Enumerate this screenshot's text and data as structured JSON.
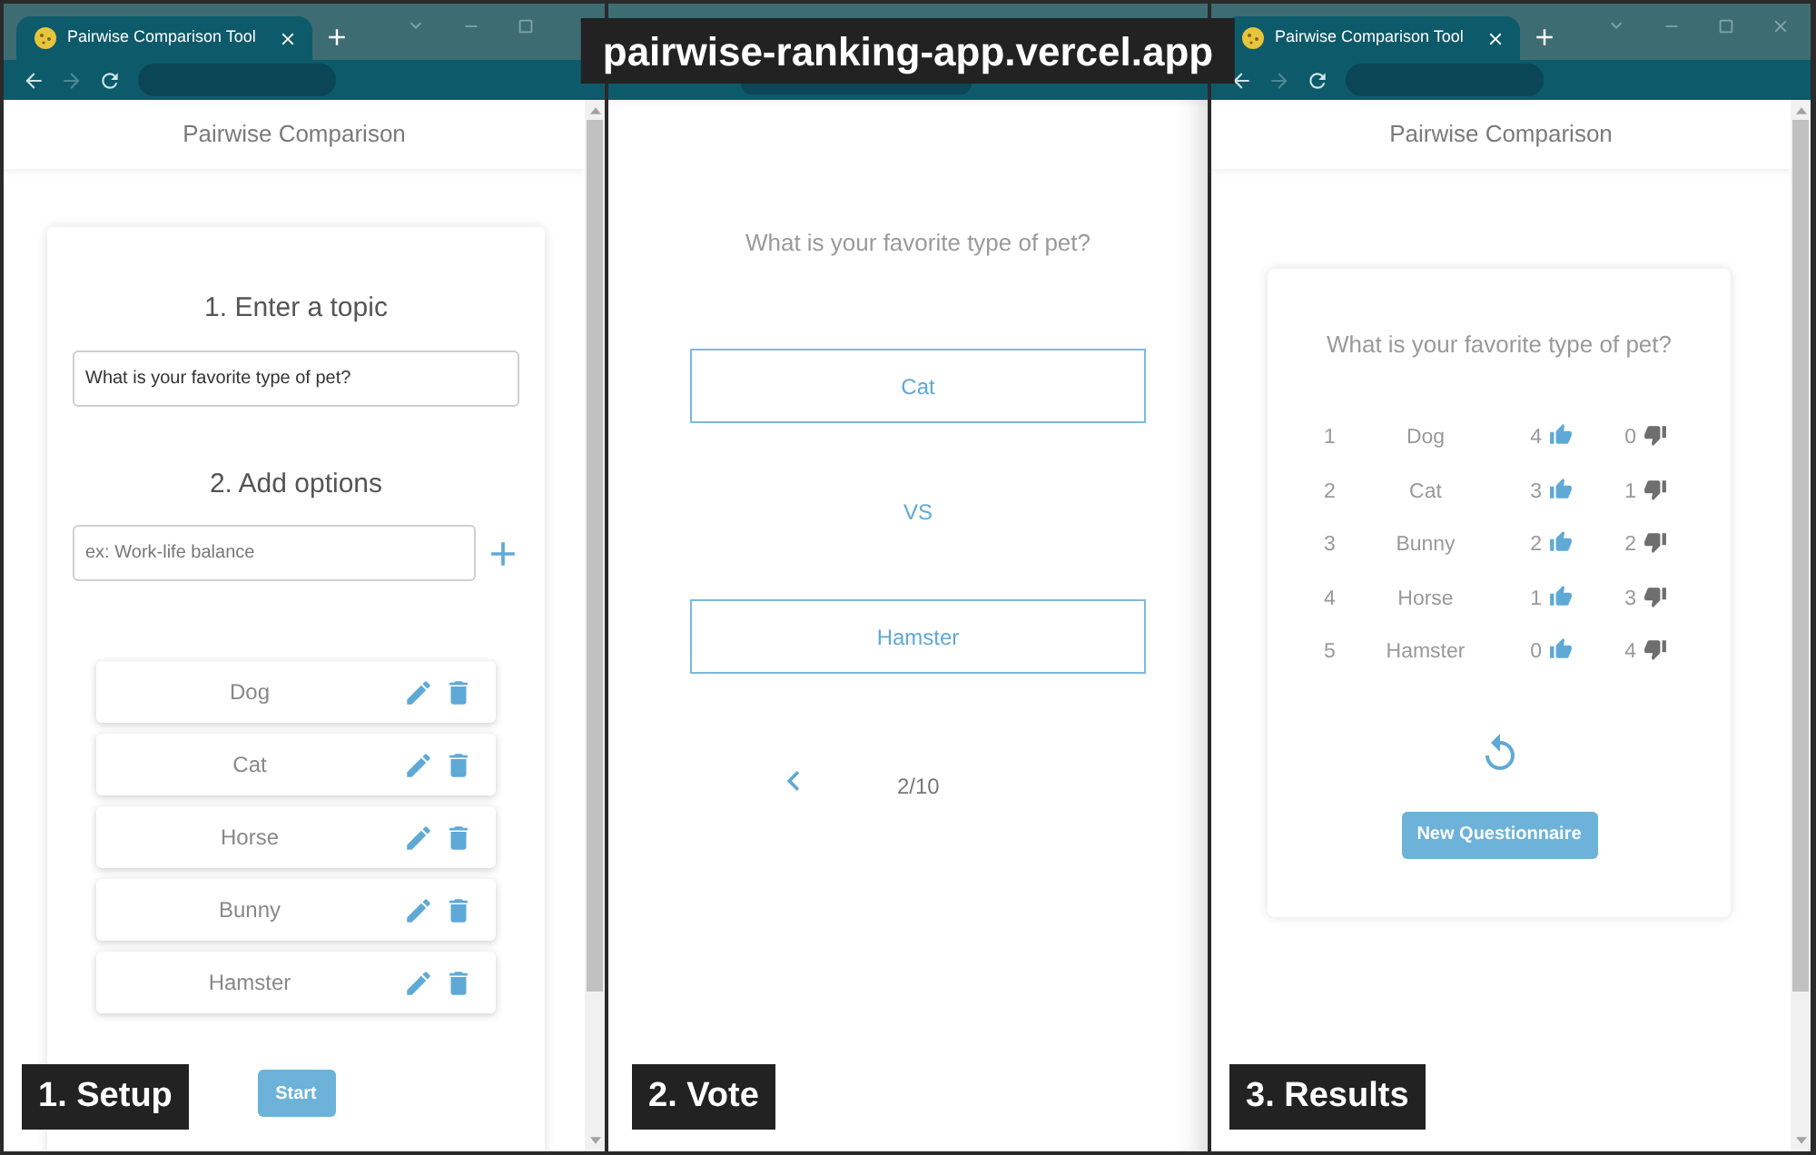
{
  "caption": "pairwise-ranking-app.vercel.app",
  "setup_window": {
    "browser": {
      "tab_title": "Pairwise Comparison Tool",
      "forward_disabled": true
    },
    "header": "Pairwise Comparison",
    "topic_heading": "1. Enter a topic",
    "topic_field": {
      "value": "What is your favorite type of pet?"
    },
    "options_heading": "2. Add options",
    "option_field": {
      "placeholder": "ex: Work-life balance"
    },
    "options": [
      "Dog",
      "Cat",
      "Horse",
      "Bunny",
      "Hamster"
    ],
    "start_button": "Start",
    "step_label": "1. Setup"
  },
  "vote_window": {
    "question": "What is your favorite type of pet?",
    "choices": [
      "Cat",
      "Hamster"
    ],
    "separator": "VS",
    "progress": "2/10",
    "step_label": "2. Vote"
  },
  "results_window": {
    "browser": {
      "tab_title": "Pairwise Comparison Tool",
      "forward_disabled": true
    },
    "header": "Pairwise Comparison",
    "question": "What is your favorite type of pet?",
    "rows": [
      {
        "rank": "1",
        "name": "Dog",
        "up_votes": "4",
        "down_votes": "0"
      },
      {
        "rank": "2",
        "name": "Cat",
        "up_votes": "3",
        "down_votes": "1"
      },
      {
        "rank": "3",
        "name": "Bunny",
        "up_votes": "2",
        "down_votes": "2"
      },
      {
        "rank": "4",
        "name": "Horse",
        "up_votes": "1",
        "down_votes": "3"
      },
      {
        "rank": "5",
        "name": "Hamster",
        "up_votes": "0",
        "down_votes": "4"
      }
    ],
    "new_button": "New Questionnaire",
    "step_label": "3. Results"
  }
}
